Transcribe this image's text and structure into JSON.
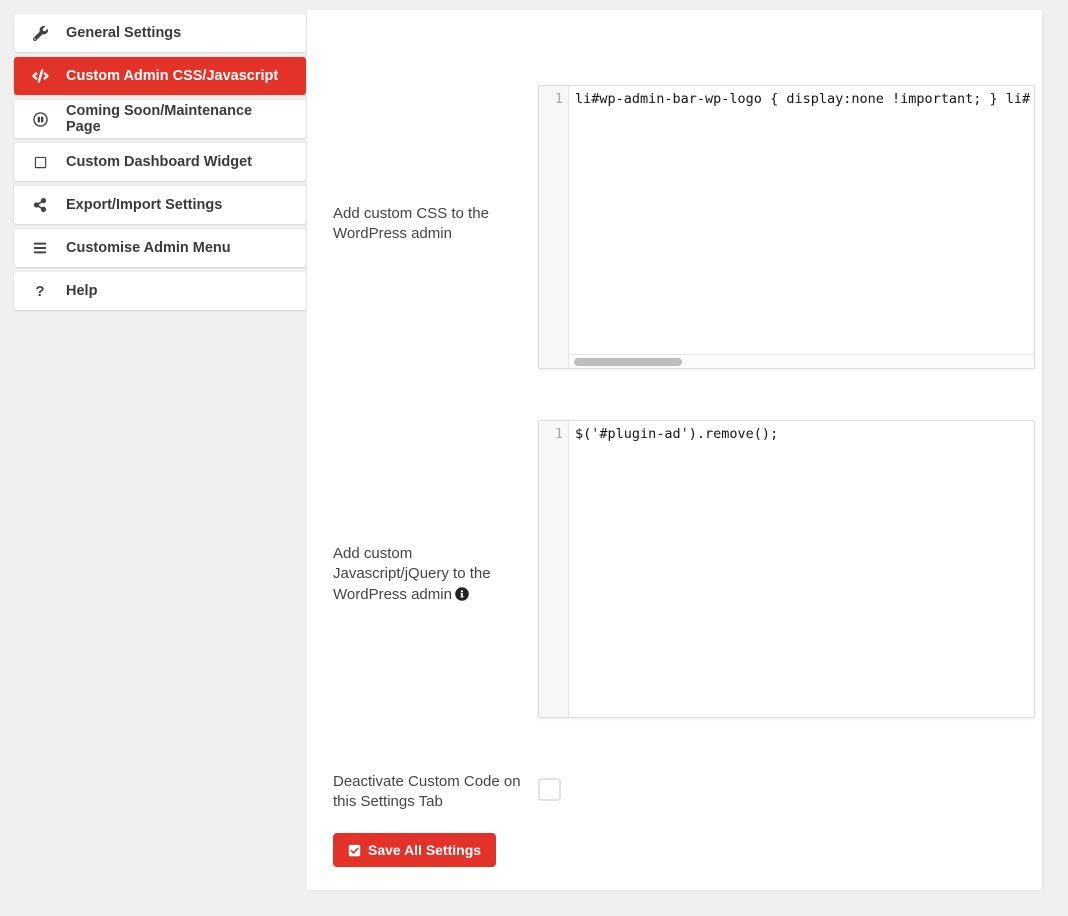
{
  "colors": {
    "accent_red": "#e33228",
    "page_bg": "#f0f0f1",
    "panel_bg": "#ffffff",
    "sidebar_text": "#3a3a3a",
    "editor_gutter_bg": "#f7f7f7",
    "scrollbar_thumb": "#bdbdbd"
  },
  "sidebar": {
    "items": [
      {
        "label": "General Settings",
        "icon": "wrench-icon",
        "active": false
      },
      {
        "label": "Custom Admin CSS/Javascript",
        "icon": "code-icon",
        "active": true
      },
      {
        "label": "Coming Soon/Maintenance Page",
        "icon": "pause-circle-icon",
        "active": false
      },
      {
        "label": "Custom Dashboard Widget",
        "icon": "square-outline-icon",
        "active": false
      },
      {
        "label": "Export/Import Settings",
        "icon": "share-icon",
        "active": false
      },
      {
        "label": "Customise Admin Menu",
        "icon": "menu-bars-icon",
        "active": false
      },
      {
        "label": "Help",
        "icon": "question-mark-icon",
        "question_glyph": "?",
        "active": false
      }
    ]
  },
  "main": {
    "css_section": {
      "label": "Add custom CSS to the WordPress admin",
      "editor": {
        "line_number": "1",
        "code": "li#wp-admin-bar-wp-logo { display:none !important; } li#",
        "has_horizontal_scrollbar": true
      }
    },
    "js_section": {
      "label": "Add custom Javascript/jQuery to the WordPress admin",
      "info_icon": "info-circle-icon",
      "editor": {
        "line_number": "1",
        "code": "$('#plugin-ad').remove();",
        "has_horizontal_scrollbar": false
      }
    },
    "deactivate": {
      "label": "Deactivate Custom Code on this Settings Tab",
      "checked": false
    },
    "save_button": {
      "label": "Save All Settings",
      "icon": "check-square-icon"
    }
  }
}
